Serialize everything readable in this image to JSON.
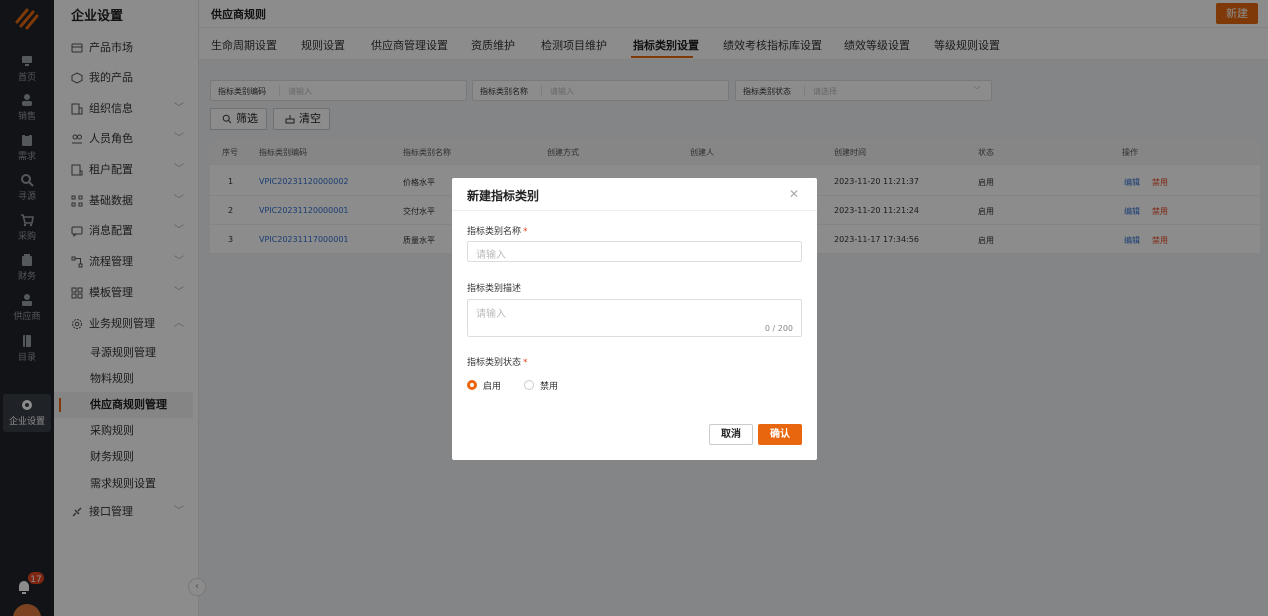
{
  "rail": {
    "items": [
      {
        "label": "首页",
        "icon": "home-icon"
      },
      {
        "label": "销售",
        "icon": "user-icon"
      },
      {
        "label": "需求",
        "icon": "clipboard-icon"
      },
      {
        "label": "寻源",
        "icon": "search-icon"
      },
      {
        "label": "采购",
        "icon": "cart-icon"
      },
      {
        "label": "财务",
        "icon": "wallet-icon"
      },
      {
        "label": "供应商",
        "icon": "supplier-icon"
      },
      {
        "label": "目录",
        "icon": "catalog-icon"
      },
      {
        "label": "企业设置",
        "icon": "settings-icon"
      }
    ],
    "badge": "17",
    "accent": "#e8660d"
  },
  "sidebar": {
    "title": "企业设置",
    "items": [
      {
        "label": "产品市场",
        "icon": "market-icon",
        "chevron": false
      },
      {
        "label": "我的产品",
        "icon": "cube-icon",
        "chevron": false
      },
      {
        "label": "组织信息",
        "icon": "building-icon",
        "chevron": true
      },
      {
        "label": "人员角色",
        "icon": "people-icon",
        "chevron": true
      },
      {
        "label": "租户配置",
        "icon": "tenant-icon",
        "chevron": true
      },
      {
        "label": "基础数据",
        "icon": "data-icon",
        "chevron": true
      },
      {
        "label": "消息配置",
        "icon": "message-icon",
        "chevron": true
      },
      {
        "label": "流程管理",
        "icon": "flow-icon",
        "chevron": true
      },
      {
        "label": "模板管理",
        "icon": "template-icon",
        "chevron": true
      },
      {
        "label": "业务规则管理",
        "icon": "gear-icon",
        "chevron": true
      }
    ],
    "sub_items": [
      {
        "label": "寻源规则管理"
      },
      {
        "label": "物料规则"
      },
      {
        "label": "供应商规则管理"
      },
      {
        "label": "采购规则"
      },
      {
        "label": "财务规则"
      },
      {
        "label": "需求规则设置"
      }
    ],
    "last_item": {
      "label": "接口管理",
      "icon": "plug-icon"
    }
  },
  "header": {
    "title": "供应商规则",
    "new_label": "新建"
  },
  "tabs": [
    "生命周期设置",
    "规则设置",
    "供应商管理设置",
    "资质维护",
    "检测项目维护",
    "指标类别设置",
    "绩效考核指标库设置",
    "绩效等级设置",
    "等级规则设置"
  ],
  "filters": {
    "code": {
      "label": "指标类别编码",
      "placeholder": "请输入"
    },
    "name": {
      "label": "指标类别名称",
      "placeholder": "请输入"
    },
    "status": {
      "label": "指标类别状态",
      "placeholder": "请选择"
    },
    "search_label": "筛选",
    "clear_label": "清空"
  },
  "table": {
    "columns": [
      "序号",
      "指标类别编码",
      "指标类别名称",
      "创建方式",
      "创建人",
      "创建时间",
      "状态",
      "操作"
    ],
    "rows": [
      {
        "index": "1",
        "code": "VPIC20231120000002",
        "name": "价格水平",
        "time": "2023-11-20 11:21:37",
        "status": "启用"
      },
      {
        "index": "2",
        "code": "VPIC20231120000001",
        "name": "交付水平",
        "time": "2023-11-20 11:21:24",
        "status": "启用"
      },
      {
        "index": "3",
        "code": "VPIC20231117000001",
        "name": "质量水平",
        "time": "2023-11-17 17:34:56",
        "status": "启用"
      }
    ],
    "edit_label": "编辑",
    "disable_label": "禁用"
  },
  "modal": {
    "title": "新建指标类别",
    "name_label": "指标类别名称",
    "name_placeholder": "请输入",
    "desc_label": "指标类别描述",
    "desc_placeholder": "请输入",
    "desc_counter": "0 / 200",
    "status_label": "指标类别状态",
    "required_mark": "*",
    "options": [
      {
        "label": "启用",
        "selected": true
      },
      {
        "label": "禁用",
        "selected": false
      }
    ],
    "cancel_label": "取消",
    "ok_label": "确认",
    "close_icon": "close-icon"
  }
}
